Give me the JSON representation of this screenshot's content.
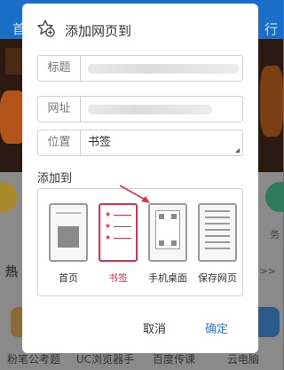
{
  "background": {
    "top_left_text": "首",
    "top_right_text": "行",
    "hot_text": "热",
    "more_text": ">>>",
    "right_note": "务",
    "apps": [
      "粉笔公考题",
      "UC浏览器手",
      "百度传课",
      "云电脑"
    ]
  },
  "dialog": {
    "title": "添加网页到",
    "fields": {
      "title_label": "标题",
      "url_label": "网址",
      "location_label": "位置",
      "location_value": "书签"
    },
    "section_label": "添加到",
    "options": [
      {
        "label": "首页",
        "selected": false
      },
      {
        "label": "书签",
        "selected": true
      },
      {
        "label": "手机桌面",
        "selected": false
      },
      {
        "label": "保存网页",
        "selected": false
      }
    ],
    "cancel_label": "取消",
    "ok_label": "确定"
  },
  "colors": {
    "accent_red": "#e0314b",
    "confirm_blue": "#2e7ee6",
    "overlay": "#6b6b6b"
  }
}
